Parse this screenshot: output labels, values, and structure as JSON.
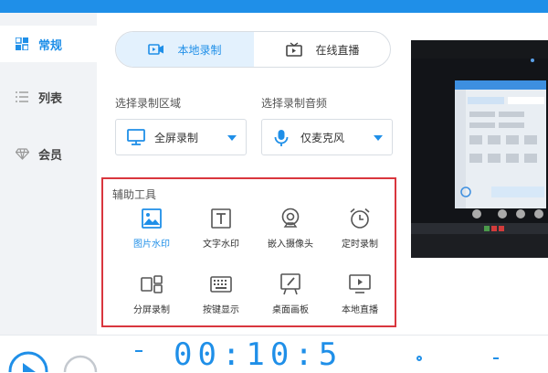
{
  "colors": {
    "accent": "#1f8fe8",
    "highlight_box": "#d9363e",
    "sidebar_bg": "#f1f3f6"
  },
  "sidebar": {
    "items": [
      {
        "label": "常规",
        "icon": "grid-icon",
        "active": true
      },
      {
        "label": "列表",
        "icon": "list-icon",
        "active": false
      },
      {
        "label": "会员",
        "icon": "diamond-icon",
        "active": false
      }
    ]
  },
  "mode_tabs": [
    {
      "label": "本地录制",
      "icon": "video-camera-icon",
      "active": true
    },
    {
      "label": "在线直播",
      "icon": "tv-icon",
      "active": false
    }
  ],
  "record_area": {
    "label": "选择录制区域",
    "value": "全屏录制",
    "icon": "monitor-icon"
  },
  "record_audio": {
    "label": "选择录制音频",
    "value": "仅麦克风",
    "icon": "microphone-icon"
  },
  "tools": {
    "title": "辅助工具",
    "items": [
      {
        "label": "图片水印",
        "icon": "image-icon",
        "active": true
      },
      {
        "label": "文字水印",
        "icon": "text-icon",
        "active": false
      },
      {
        "label": "嵌入摄像头",
        "icon": "webcam-icon",
        "active": false
      },
      {
        "label": "定时录制",
        "icon": "alarm-clock-icon",
        "active": false
      },
      {
        "label": "分屏录制",
        "icon": "split-screen-icon",
        "active": false
      },
      {
        "label": "按键显示",
        "icon": "keyboard-icon",
        "active": false
      },
      {
        "label": "桌面画板",
        "icon": "drawing-board-icon",
        "active": false
      },
      {
        "label": "本地直播",
        "icon": "play-screen-icon",
        "active": false
      }
    ]
  },
  "player": {
    "timer": "00:10:5"
  }
}
